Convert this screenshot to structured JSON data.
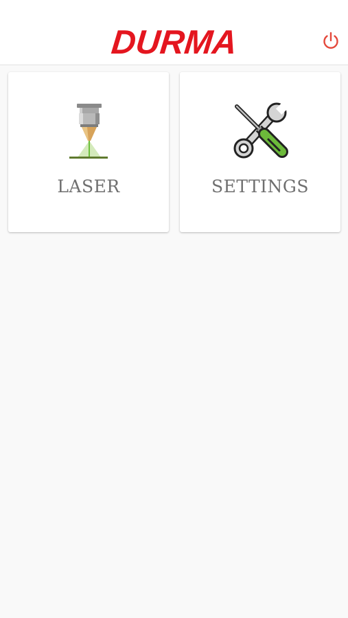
{
  "header": {
    "brand": "DURMA",
    "brand_color": "#e4161f",
    "power_icon": "power-icon",
    "power_color": "#e4483b"
  },
  "tiles": [
    {
      "label": "LASER",
      "icon": "laser-head-icon"
    },
    {
      "label": "SETTINGS",
      "icon": "wrench-screwdriver-icon"
    }
  ]
}
